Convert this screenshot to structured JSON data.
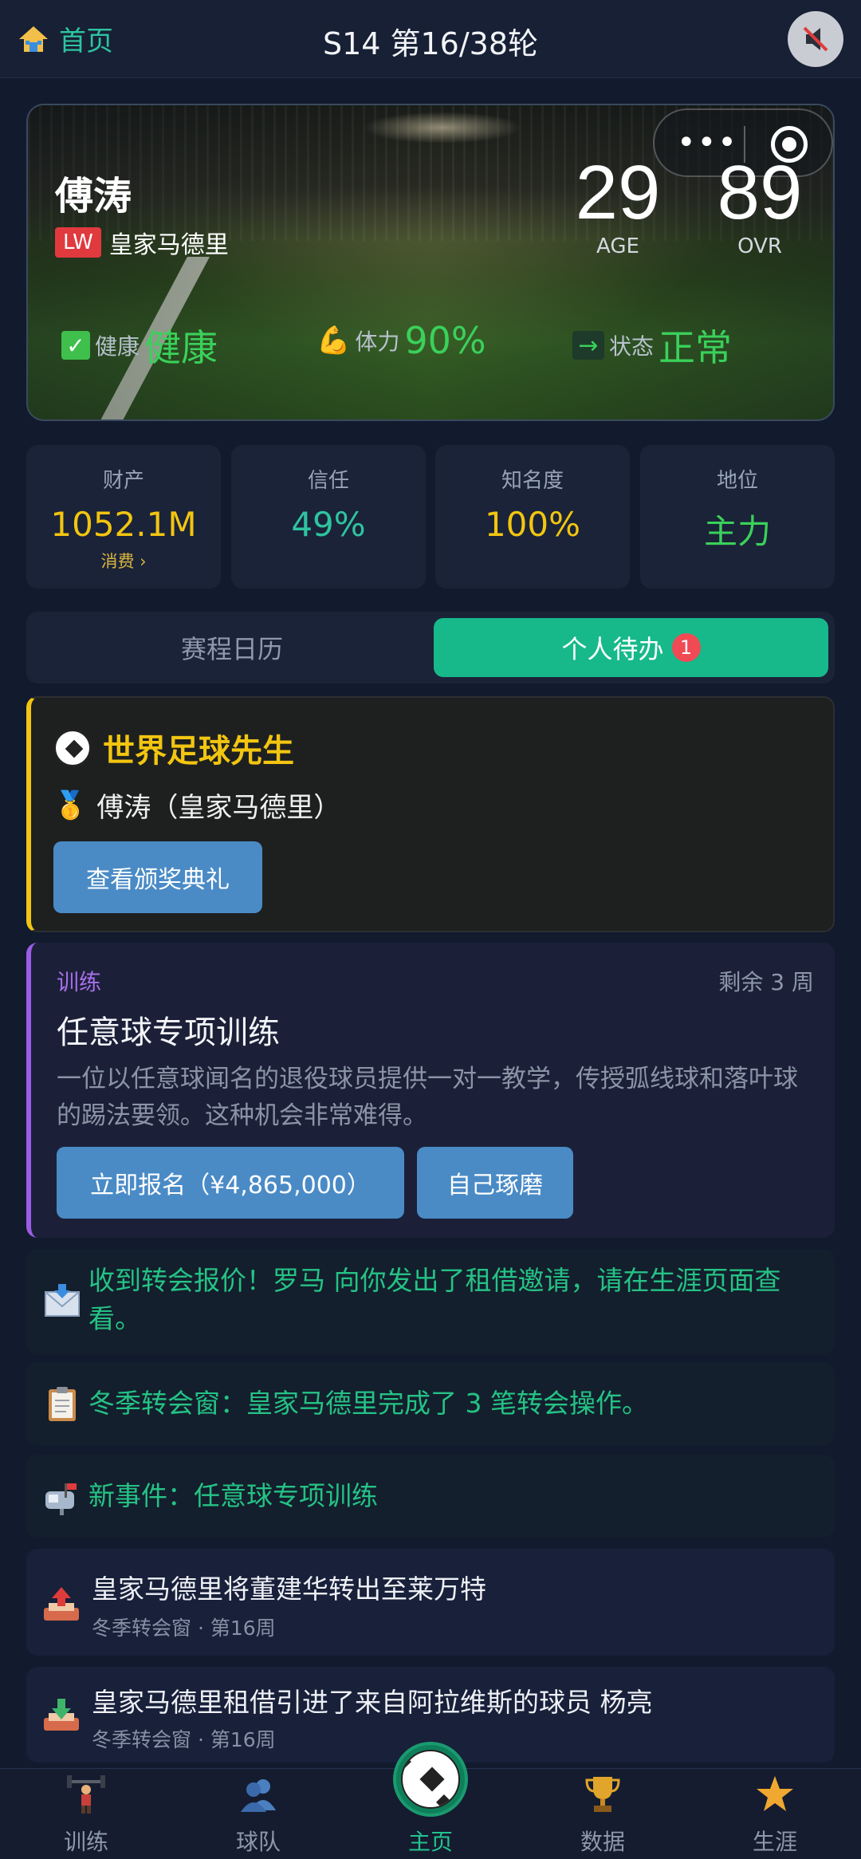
{
  "header": {
    "home_label": "首页",
    "round_title": "S14 第16/38轮",
    "home_icon": "house-icon",
    "mute_icon": "mute-icon"
  },
  "player": {
    "name": "傅涛",
    "position": "LW",
    "club": "皇家马德里",
    "age": "29",
    "age_label": "AGE",
    "ovr": "89",
    "ovr_label": "OVR",
    "health_label": "健康",
    "health_value": "健康",
    "stamina_label": "体力",
    "stamina_value": "90%",
    "form_label": "状态",
    "form_value": "正常"
  },
  "stats": [
    {
      "title": "财产",
      "value": "1052.1M",
      "sub": "消费 ›",
      "color": "#f2c511"
    },
    {
      "title": "信任",
      "value": "49%",
      "color": "#2ec4a0"
    },
    {
      "title": "知名度",
      "value": "100%",
      "color": "#f2c511"
    },
    {
      "title": "地位",
      "value": "主力",
      "color": "#3ad15a"
    }
  ],
  "tabs": {
    "schedule": "赛程日历",
    "todo": "个人待办",
    "todo_badge": "1"
  },
  "award": {
    "title": "世界足球先生",
    "winner": "傅涛（皇家马德里）",
    "button": "查看颁奖典礼",
    "accent": "#f2c511"
  },
  "training": {
    "tag": "训练",
    "remaining": "剩余 3 周",
    "title": "任意球专项训练",
    "description": "一位以任意球闻名的退役球员提供一对一教学，传授弧线球和落叶球的踢法要领。这种机会非常难得。",
    "enroll_button": "立即报名（¥4,865,000）",
    "self_button": "自己琢磨",
    "accent": "#9b5de5"
  },
  "notices": [
    {
      "icon": "envelope-icon",
      "text": "收到转会报价！罗马 向你发出了租借邀请，请在生涯页面查看。"
    },
    {
      "icon": "clipboard-icon",
      "text": "冬季转会窗：皇家马德里完成了 3 笔转会操作。"
    },
    {
      "icon": "mailbox-icon",
      "text": "新事件：任意球专项训练"
    }
  ],
  "events": [
    {
      "icon": "outbox-icon",
      "text": "皇家马德里将董建华转出至莱万特",
      "meta": "冬季转会窗 · 第16周"
    },
    {
      "icon": "inbox-icon",
      "text": "皇家马德里租借引进了来自阿拉维斯的球员 杨亮",
      "meta": "冬季转会窗 · 第16周"
    }
  ],
  "nav": [
    {
      "label": "训练",
      "icon": "weightlifter-icon"
    },
    {
      "label": "球队",
      "icon": "team-icon"
    },
    {
      "label": "主页",
      "icon": "soccer-ball-icon",
      "active": true
    },
    {
      "label": "数据",
      "icon": "trophy-icon"
    },
    {
      "label": "生涯",
      "icon": "star-icon"
    }
  ]
}
